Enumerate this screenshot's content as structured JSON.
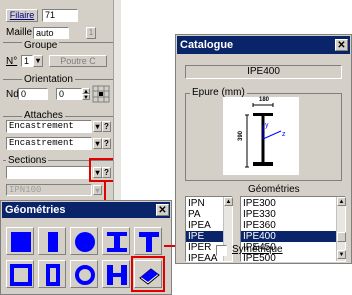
{
  "panel": {
    "filaire_label": "Filaire",
    "filaire_value": "71",
    "maille_label": "Maille",
    "maille_value": "auto",
    "maille_count": "1",
    "groupe_title": "Groupe",
    "groupe_num_label": "N°",
    "groupe_num_value": "1",
    "poutre_label": "Poutre C",
    "orientation_title": "Orientation",
    "nd_label": "Nd",
    "nd_value": "0",
    "orient_value": "0",
    "attaches_title": "Attaches",
    "attache1": "Encastrement",
    "attache2": "Encastrement",
    "sections_title": "Sections",
    "section_value": "",
    "section_disabled_value": "IPN100",
    "combo_button_label": "?"
  },
  "geometries_window": {
    "title": "Géométries",
    "close": "✕",
    "tools": [
      "filled-square",
      "filled-rectangle",
      "filled-circle",
      "i-beam",
      "t-beam",
      "hollow-square",
      "hollow-rectangle",
      "hollow-circle",
      "h-beam",
      "catalogue-book"
    ]
  },
  "catalogue_window": {
    "title": "Catalogue",
    "close": "✕",
    "selected_profile": "IPE400",
    "epure_label": "Epure (mm)",
    "dim_width": "180",
    "dim_height": "390",
    "axis_y": "y",
    "axis_z": "z",
    "geometries_label": "Géométries",
    "families": [
      "IPN",
      "PA",
      "IPEA",
      "IPE",
      "IPER",
      "IPEAA"
    ],
    "families_selected": "IPE",
    "sizes": [
      "IPE300",
      "IPE330",
      "IPE360",
      "IPE400",
      "IPE450",
      "IPE500"
    ],
    "sizes_selected": "IPE400",
    "symetrique_label": "Symétrique"
  },
  "colors": {
    "titlebar": "#0a246a",
    "highlight": "#e00000",
    "tool_icon": "#0000ff",
    "face": "#d4d0c8"
  }
}
